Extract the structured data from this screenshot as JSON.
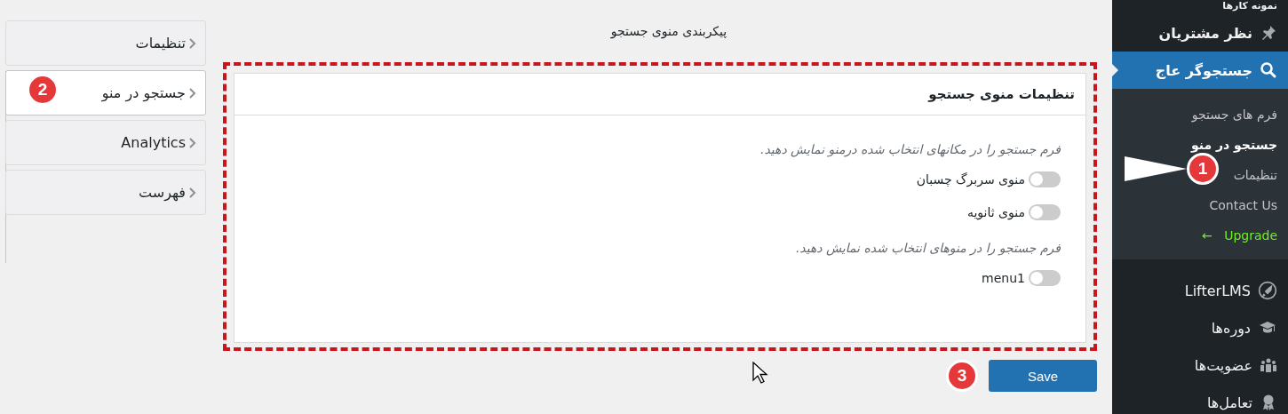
{
  "admin_menu": {
    "items": [
      {
        "label": "نمونه کارها",
        "selected": false
      },
      {
        "label": "نظر مشتریان",
        "selected": false
      },
      {
        "label": "جستجوگر عاج",
        "selected": true,
        "submenu": [
          {
            "label": "فرم های جستجو",
            "selected": false,
            "kind": "link"
          },
          {
            "label": "جستجو در منو",
            "selected": true,
            "kind": "link"
          },
          {
            "label": "تنظیمات",
            "selected": false,
            "kind": "link"
          },
          {
            "label": "Contact Us",
            "selected": false,
            "kind": "link"
          },
          {
            "label": "Upgrade",
            "arrow": "←",
            "selected": false,
            "kind": "upgrade"
          }
        ]
      },
      {
        "label": "LifterLMS",
        "selected": false
      },
      {
        "label": "دوره‌ها",
        "selected": false
      },
      {
        "label": "عضویت‌ها",
        "selected": false
      },
      {
        "label": "تعامل‌ها",
        "selected": false
      }
    ]
  },
  "page_title": "پیکربندی منوی جستجو",
  "tabs": [
    {
      "label": "تنظیمات",
      "selected": false
    },
    {
      "label": "جستجو در منو",
      "selected": true
    },
    {
      "label": "Analytics",
      "selected": false
    },
    {
      "label": "فهرست",
      "selected": false
    }
  ],
  "panel": {
    "title": "تنظیمات منوی جستجو",
    "sections": [
      {
        "description": "فرم جستجو را در مکانهای انتخاب شده درمنو نمایش دهید.",
        "toggles": [
          {
            "label": "منوی سربرگ چسبان",
            "on": false
          },
          {
            "label": "منوی ثانویه",
            "on": false
          }
        ]
      },
      {
        "description": "فرم جستجو را در منوهای انتخاب شده نمایش دهید.",
        "toggles": [
          {
            "label": "menu1",
            "on": false
          }
        ]
      }
    ]
  },
  "save_button": "Save",
  "callouts": [
    {
      "label": "1"
    },
    {
      "label": "2"
    },
    {
      "label": "3"
    }
  ]
}
